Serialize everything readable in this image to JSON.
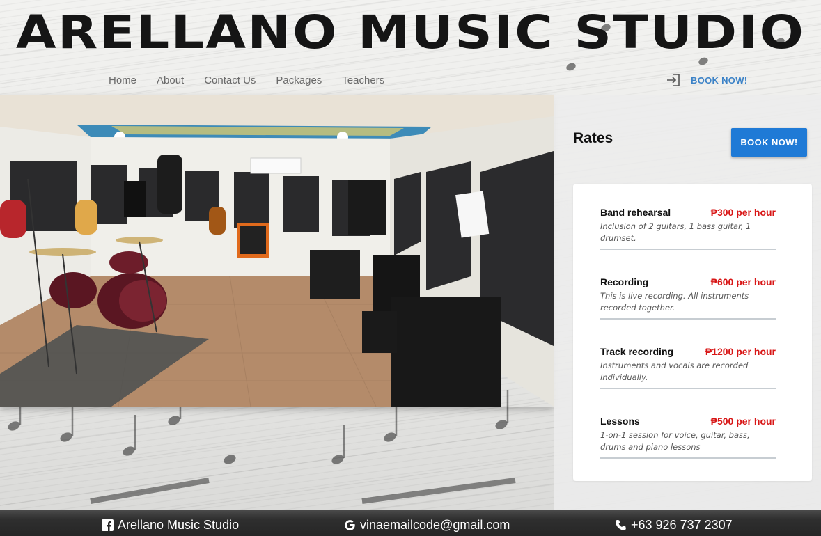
{
  "header": {
    "title": "ARELLANO MUSIC STUDIO"
  },
  "nav": {
    "items": [
      "Home",
      "About",
      "Contact Us",
      "Packages",
      "Teachers"
    ],
    "book_label": "BOOK NOW!",
    "book_icon": "login-icon"
  },
  "rates": {
    "title": "Rates",
    "book_button": "BOOK NOW!",
    "items": [
      {
        "name": "Band rehearsal",
        "price": "₱300 per hour",
        "description": "Inclusion of 2 guitars, 1 bass guitar, 1 drumset."
      },
      {
        "name": "Recording",
        "price": "₱600 per hour",
        "description": "This is live recording. All instruments recorded together."
      },
      {
        "name": "Track recording",
        "price": "₱1200 per hour",
        "description": "Instruments and vocals are recorded individually."
      },
      {
        "name": "Lessons",
        "price": "₱500 per hour",
        "description": "1-on-1 session for voice, guitar, bass, drums and piano lessons"
      }
    ]
  },
  "footer": {
    "facebook": "Arellano Music Studio",
    "email": "vinaemailcode@gmail.com",
    "phone": "+63 926 737 2307",
    "icons": [
      "facebook-icon",
      "google-icon",
      "phone-icon"
    ]
  },
  "colors": {
    "accent": "#1f7ad6",
    "nav_link_accent": "#3b82c7",
    "price": "#d81616",
    "footer": "#262626"
  }
}
